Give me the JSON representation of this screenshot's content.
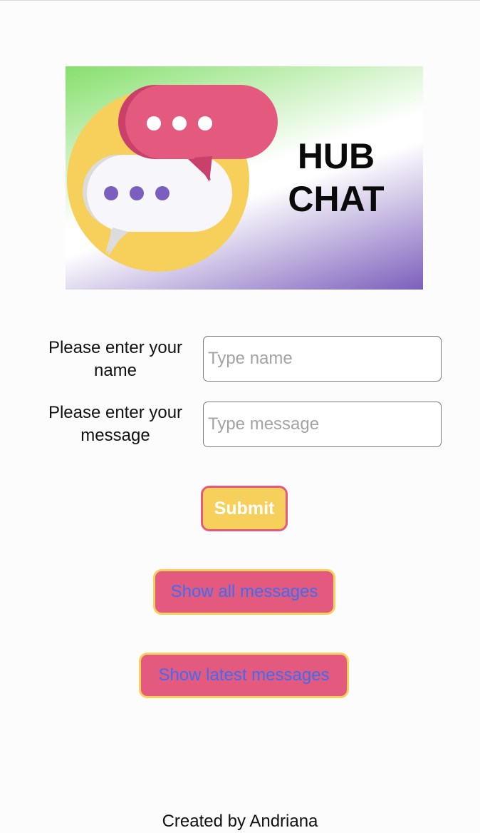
{
  "logo": {
    "title_line1": "HUB",
    "title_line2": "CHAT",
    "icon": "chat-bubbles-icon",
    "colors": {
      "circle": "#f6d05a",
      "pink_bubble": "#e35a7e",
      "white_bubble": "#f7f7fb",
      "dots_purple": "#7a5fbf"
    }
  },
  "form": {
    "name_label": "Please enter your name",
    "name_placeholder": "Type name",
    "message_label": "Please enter your message",
    "message_placeholder": "Type message",
    "submit_label": "Submit"
  },
  "actions": {
    "show_all_label": "Show all messages",
    "show_latest_label": "Show latest messages"
  },
  "footer": {
    "text": "Created by Andriana"
  },
  "colors": {
    "yellow": "#f6d05a",
    "pink": "#e35a7e",
    "link_blue": "#3d6cf5"
  }
}
